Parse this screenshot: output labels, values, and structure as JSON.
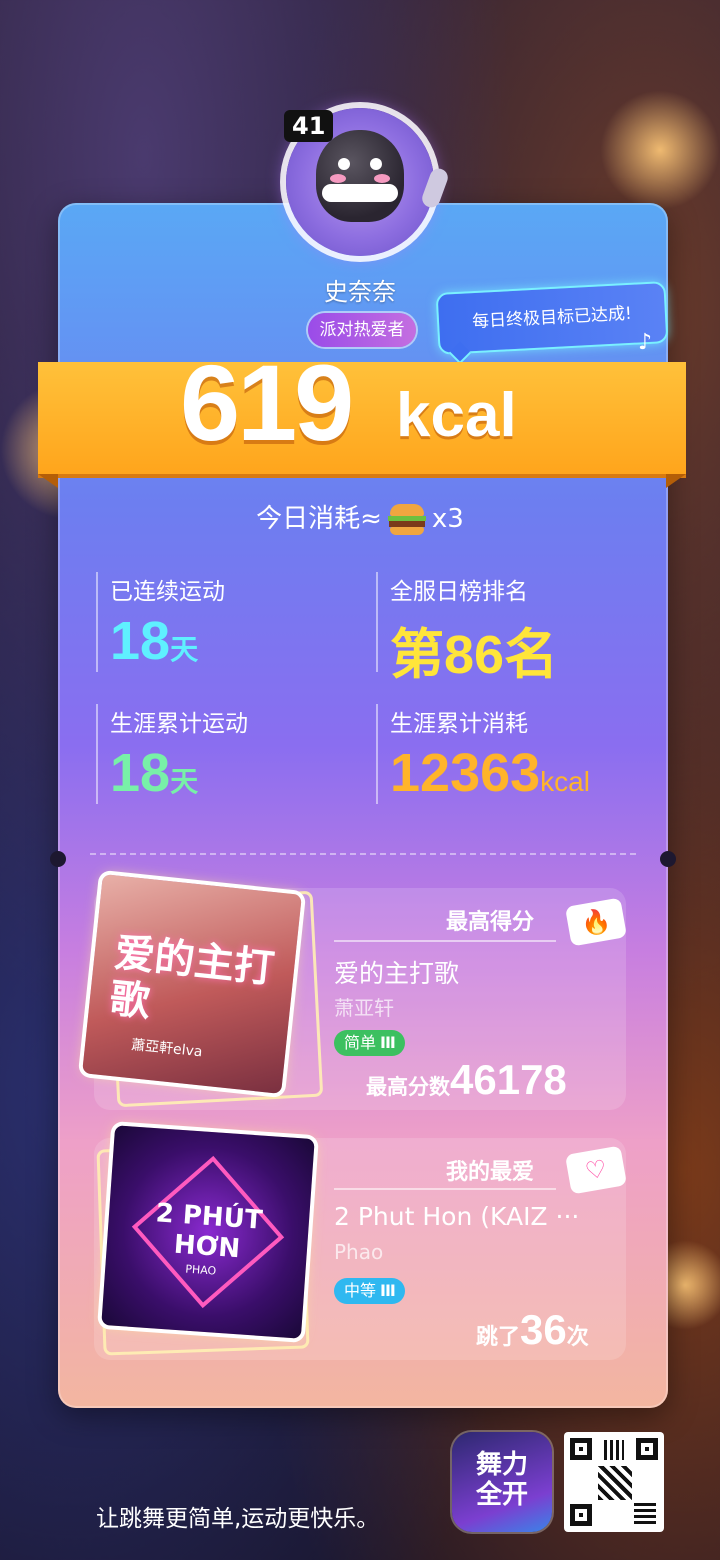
{
  "profile": {
    "level": "41",
    "name": "史奈奈",
    "title_badge": "派对热爱者",
    "goal_message": "每日终极目标已达成!"
  },
  "calories": {
    "value": "619",
    "unit": "kcal"
  },
  "today": {
    "prefix": "今日消耗≈",
    "suffix": "x3",
    "icon": "burger-icon"
  },
  "stats": [
    {
      "label": "已连续运动",
      "value": "18",
      "unit": "天",
      "color": "#5ff0ff"
    },
    {
      "label": "全服日榜排名",
      "value": "第86名",
      "unit": "",
      "color": "#ffe53a"
    },
    {
      "label": "生涯累计运动",
      "value": "18",
      "unit": "天",
      "color": "#78f0a8"
    },
    {
      "label": "生涯累计消耗",
      "value": "12363",
      "unit": "kcal",
      "color": "#ffb42a"
    }
  ],
  "best_score": {
    "section_title": "最高得分",
    "icon": "flame-icon",
    "cover_title": "爱的主打歌",
    "cover_artist": "蕭亞軒elva",
    "song": "爱的主打歌",
    "artist": "萧亚轩",
    "difficulty": "简单",
    "difficulty_color": "#3cc060",
    "stat_label": "最高分数",
    "stat_value": "46178"
  },
  "favorite": {
    "section_title": "我的最爱",
    "icon": "heart-icon",
    "cover_title": "2 PHÚT HƠN",
    "cover_artist": "PHAO",
    "song": "2 Phut Hon (KAIZ ···",
    "artist": "Phao",
    "difficulty": "中等",
    "difficulty_color": "#2fb8f0",
    "stat_prefix": "跳了",
    "stat_value": "36",
    "stat_suffix": "次"
  },
  "footer": {
    "slogan": "让跳舞更简单,运动更快乐。",
    "app_name": "舞力全开",
    "qr_icon": "qr-code-icon"
  }
}
